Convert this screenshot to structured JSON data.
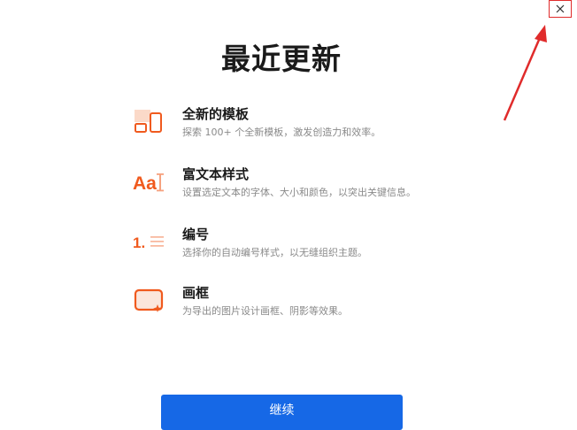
{
  "dialog": {
    "title": "最近更新",
    "close_icon": "close-icon",
    "continue_label": "继续"
  },
  "features": [
    {
      "icon": "template-icon",
      "title": "全新的模板",
      "description": "探索 100+ 个全新模板，激发创造力和效率。"
    },
    {
      "icon": "rich-text-icon",
      "title": "富文本样式",
      "description": "设置选定文本的字体、大小和颜色，以突出关键信息。"
    },
    {
      "icon": "numbering-icon",
      "title": "编号",
      "description": "选择你的自动编号样式，以无缝组织主题。"
    },
    {
      "icon": "frame-icon",
      "title": "画框",
      "description": "为导出的图片设计画框、阴影等效果。"
    }
  ],
  "colors": {
    "accent": "#1668e6",
    "icon_orange": "#f05a1e",
    "icon_light": "#fbd9c8",
    "annotation_red": "#e02b2b"
  },
  "icon_glyphs": {
    "rich_text": "Aa",
    "numbering": "1."
  }
}
